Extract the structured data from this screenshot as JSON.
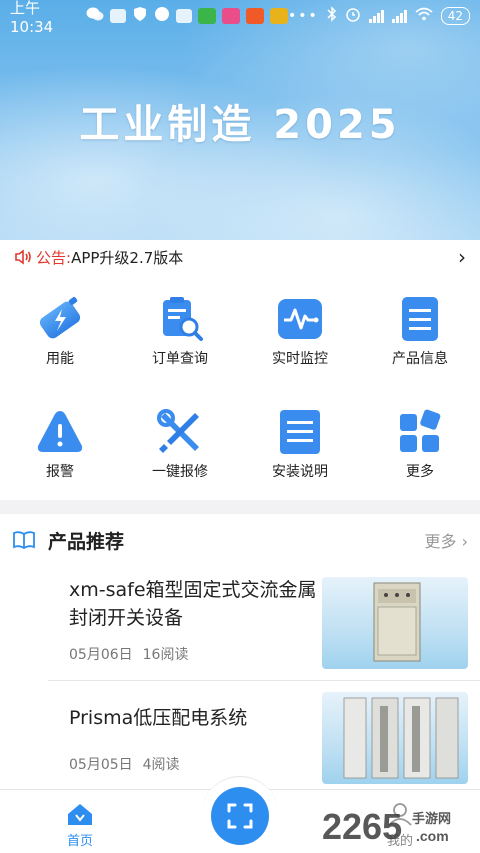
{
  "status_bar": {
    "time": "上午10:34",
    "battery": "42"
  },
  "banner": {
    "title": "工业制造 2025"
  },
  "notice": {
    "label": "公告:",
    "text": " APP升级2.7版本"
  },
  "grid": [
    {
      "label": "用能",
      "icon": "energy-icon"
    },
    {
      "label": "订单查询",
      "icon": "order-search-icon"
    },
    {
      "label": "实时监控",
      "icon": "monitor-icon"
    },
    {
      "label": "产品信息",
      "icon": "list-icon"
    },
    {
      "label": "报警",
      "icon": "alarm-icon"
    },
    {
      "label": "一键报修",
      "icon": "repair-tools-icon"
    },
    {
      "label": "安装说明",
      "icon": "document-icon"
    },
    {
      "label": "更多",
      "icon": "more-grid-icon"
    }
  ],
  "products": {
    "title": "产品推荐",
    "more": "更多",
    "items": [
      {
        "title": "xm-safe箱型固定式交流金属封闭开关设备",
        "date": "05月06日",
        "reads": "16阅读"
      },
      {
        "title": "Prisma低压配电系统",
        "date": "05月05日",
        "reads": "4阅读"
      }
    ]
  },
  "bottom_nav": {
    "home": "首页",
    "mine": "我的"
  },
  "watermark": {
    "text": "2265",
    "domain": "手游网",
    "url": ".com"
  },
  "colors": {
    "accent": "#2d8ef0",
    "notice_red": "#e03a2f"
  }
}
